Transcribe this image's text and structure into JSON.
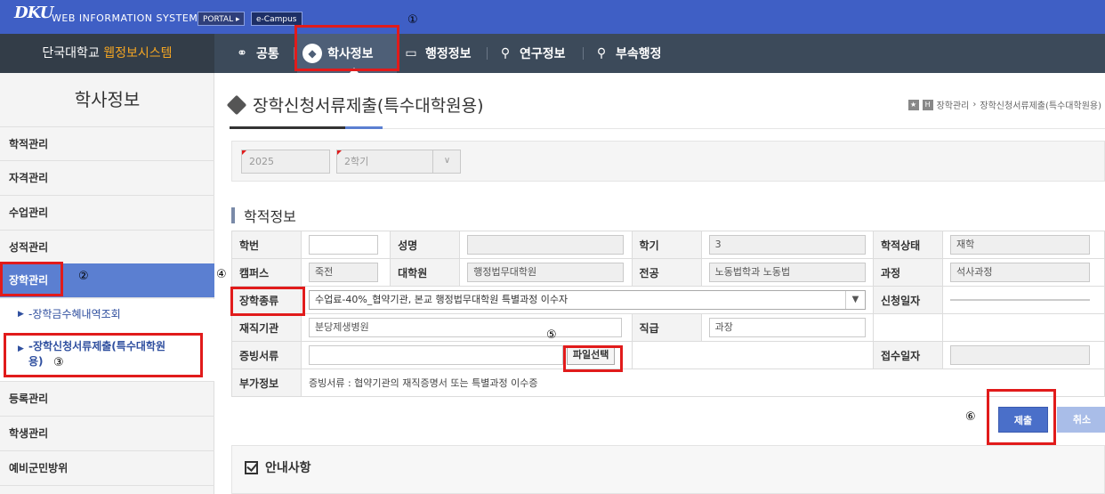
{
  "header": {
    "logo": "DKU",
    "system_name": "WEB INFORMATION SYSTEM",
    "portal": "PORTAL ▸",
    "ecampus": "e-Campus"
  },
  "brand": {
    "prefix": "단국대학교 ",
    "highlight": "웹정보시스템"
  },
  "nav": [
    {
      "label": "공통",
      "icon": "share-icon"
    },
    {
      "label": "학사정보",
      "icon": "tag-icon",
      "active": true
    },
    {
      "label": "행정정보",
      "icon": "inbox-icon"
    },
    {
      "label": "연구정보",
      "icon": "search-icon"
    },
    {
      "label": "부속행정",
      "icon": "search-icon"
    }
  ],
  "sidebar": {
    "title": "학사정보",
    "items": [
      "학적관리",
      "자격관리",
      "수업관리",
      "성적관리",
      "장학관리",
      "등록관리",
      "학생관리",
      "예비군민방위"
    ],
    "sub_items": [
      "-장학금수혜내역조회",
      "-장학신청서류제출(특수대학원",
      "용)"
    ]
  },
  "page": {
    "title": "장학신청서류제출(특수대학원용)",
    "breadcrumb": [
      "장학관리",
      "장학신청서류제출(특수대학원용)"
    ]
  },
  "search": {
    "year": "2025",
    "semester": "2학기"
  },
  "section": {
    "title": "학적정보"
  },
  "form": {
    "labels": {
      "student_id": "학번",
      "name": "성명",
      "semester": "학기",
      "status": "학적상태",
      "campus": "캠퍼스",
      "graduate_school": "대학원",
      "major": "전공",
      "course": "과정",
      "scholarship_type": "장학종류",
      "apply_date": "신청일자",
      "workplace": "재직기관",
      "position": "직급",
      "evidence": "증빙서류",
      "receipt_date": "접수일자",
      "extra": "부가정보"
    },
    "values": {
      "student_id": "",
      "name": "",
      "semester": "3",
      "status": "재학",
      "campus": "죽전",
      "graduate_school": "행정법무대학원",
      "major": "노동법학과 노동법",
      "course": "석사과정",
      "scholarship_type": "수업료-40%_협약기관, 본교 행정법무대학원 특별과정 이수자",
      "apply_date": "",
      "workplace": "분당제생병원",
      "position": "과장",
      "evidence": "",
      "receipt_date": "",
      "extra": "증빙서류 : 협약기관의 재직증명서 또는 특별과정 이수증"
    },
    "file_button": "파일선택"
  },
  "buttons": {
    "submit": "제출",
    "cancel": "취소"
  },
  "notice": {
    "title": "안내사항"
  },
  "annotations": [
    "①",
    "②",
    "③",
    "④",
    "⑤",
    "⑥"
  ],
  "colors": {
    "topbar": "#3f5fc5",
    "navbar": "#3c4a5a",
    "accent": "#5b7fd1",
    "highlight": "#e11b1b",
    "brand_orange": "#f5a623"
  }
}
